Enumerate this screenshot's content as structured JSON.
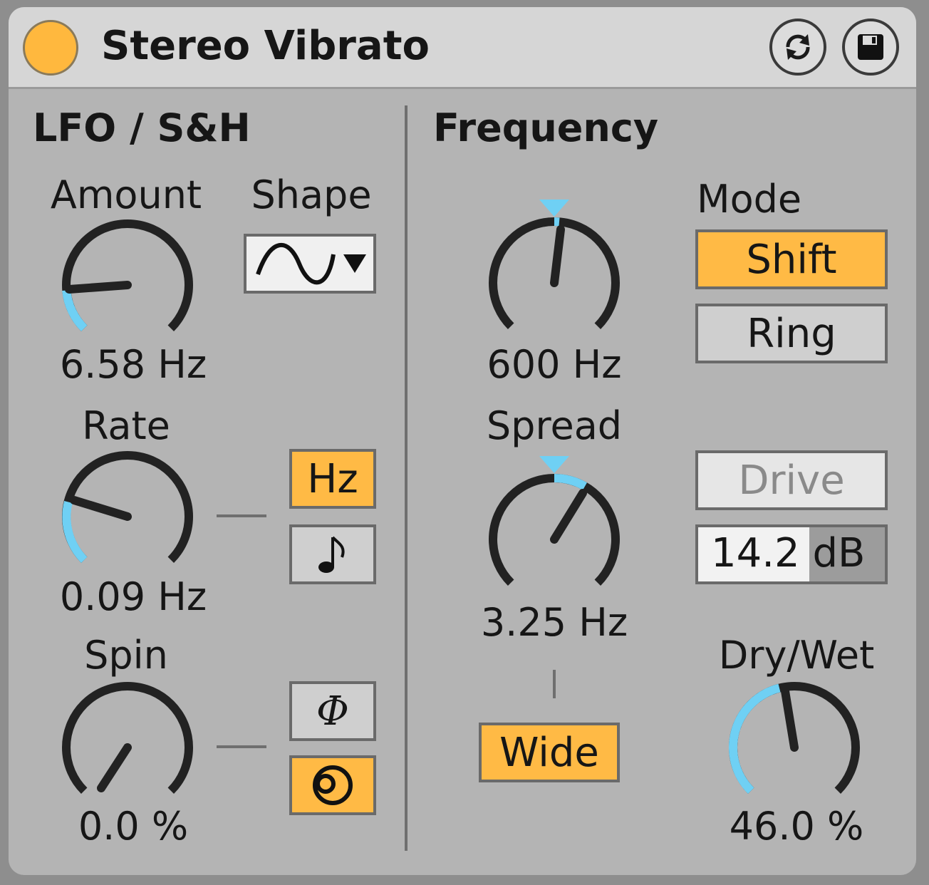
{
  "device": {
    "title": "Stereo Vibrato",
    "colors": {
      "accent": "#ffba45",
      "modulation": "#6fd0f4",
      "panel": "#b4b4b4"
    }
  },
  "lfo": {
    "heading": "LFO / S&H",
    "amount": {
      "label": "Amount",
      "value": "6.58 Hz"
    },
    "shape": {
      "label": "Shape",
      "icon": "sine-wave-icon"
    },
    "rate": {
      "label": "Rate",
      "value": "0.09 Hz",
      "hz_label": "Hz",
      "sync_icon": "music-note-icon"
    },
    "spin": {
      "label": "Spin",
      "value": "0.0 %",
      "phase_symbol": "Φ",
      "spin_icon": "spin-icon"
    }
  },
  "frequency": {
    "heading": "Frequency",
    "freq": {
      "value": "600 Hz"
    },
    "spread": {
      "label": "Spread",
      "value": "3.25 Hz"
    },
    "wide_label": "Wide",
    "mode": {
      "label": "Mode",
      "options": [
        "Shift",
        "Ring"
      ],
      "selected": "Shift"
    },
    "drive": {
      "label": "Drive",
      "value": "14.2",
      "unit": "dB"
    },
    "dry_wet": {
      "label": "Dry/Wet",
      "value": "46.0 %"
    }
  }
}
